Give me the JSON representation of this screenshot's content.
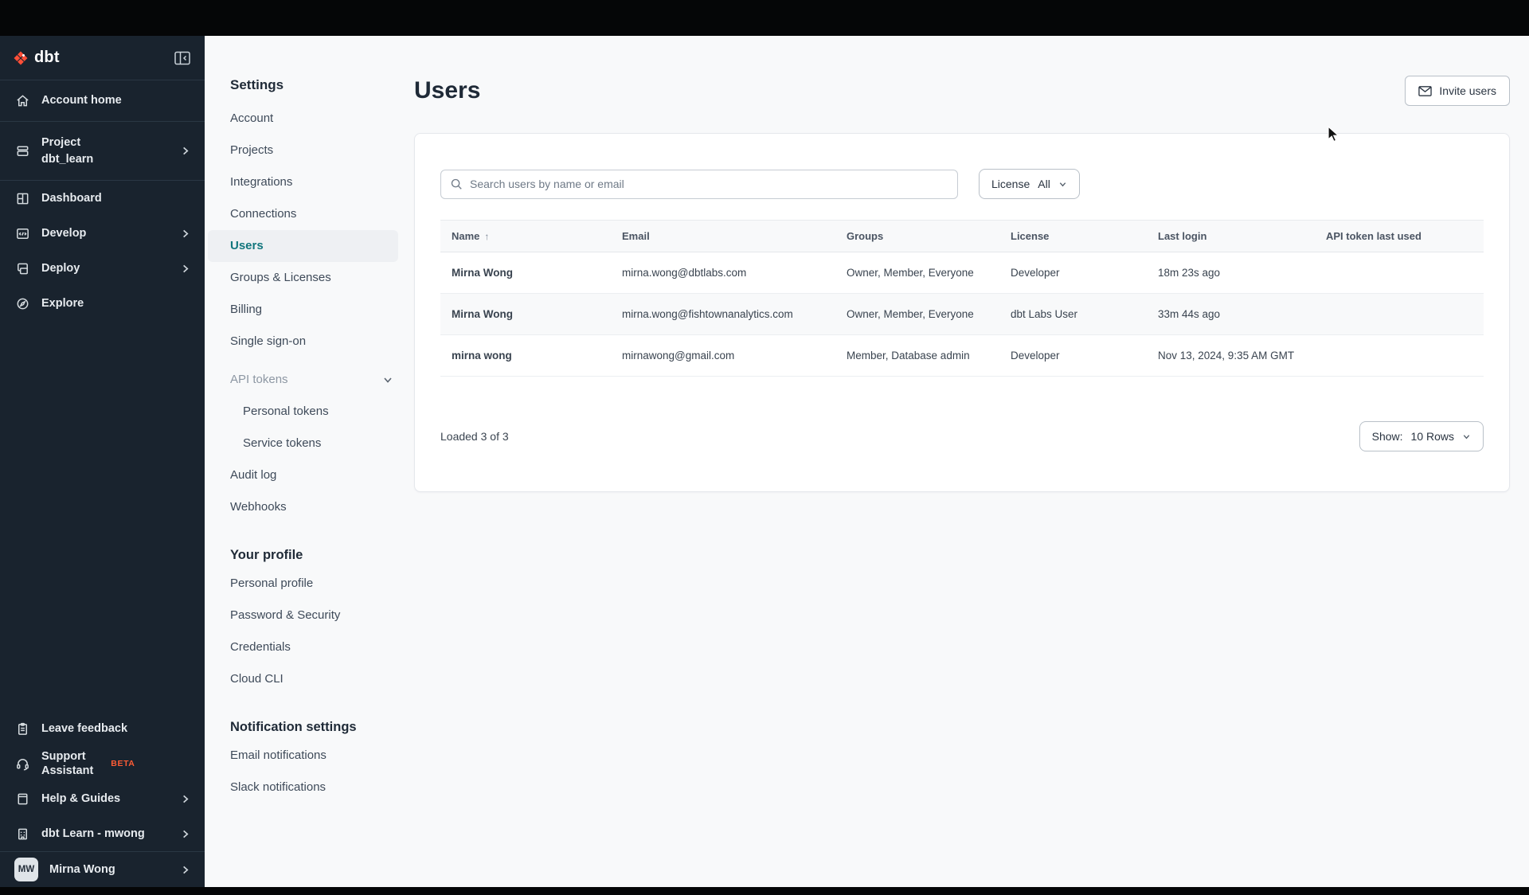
{
  "sidebar": {
    "logo_text": "dbt",
    "items": [
      {
        "label": "Account home"
      },
      {
        "label": "Project",
        "sublabel": "dbt_learn"
      },
      {
        "label": "Dashboard"
      },
      {
        "label": "Develop"
      },
      {
        "label": "Deploy"
      },
      {
        "label": "Explore"
      }
    ],
    "footer_items": [
      {
        "label": "Leave feedback"
      },
      {
        "label": "Support Assistant",
        "badge": "BETA"
      },
      {
        "label": "Help & Guides"
      },
      {
        "label": "dbt Learn - mwong"
      }
    ],
    "user": {
      "initials": "MW",
      "name": "Mirna Wong"
    }
  },
  "settings_nav": {
    "title": "Settings",
    "items": [
      "Account",
      "Projects",
      "Integrations",
      "Connections",
      "Users",
      "Groups & Licenses",
      "Billing",
      "Single sign-on"
    ],
    "active_item": "Users",
    "api_tokens_label": "API tokens",
    "api_tokens_children": [
      "Personal tokens",
      "Service tokens"
    ],
    "items_after": [
      "Audit log",
      "Webhooks"
    ],
    "profile_title": "Your profile",
    "profile_items": [
      "Personal profile",
      "Password & Security",
      "Credentials",
      "Cloud CLI"
    ],
    "notifications_title": "Notification settings",
    "notification_items": [
      "Email notifications",
      "Slack notifications"
    ]
  },
  "main": {
    "title": "Users",
    "invite_button_label": "Invite users",
    "search_placeholder": "Search users by name or email",
    "license_filter_label": "License",
    "license_filter_value": "All",
    "table": {
      "columns": [
        "Name",
        "Email",
        "Groups",
        "License",
        "Last login",
        "API token last used"
      ],
      "sort_column": "Name",
      "sort_direction": "asc",
      "rows": [
        {
          "name": "Mirna Wong",
          "email": "mirna.wong@dbtlabs.com",
          "groups": "Owner, Member, Everyone",
          "license": "Developer",
          "last_login": "18m 23s ago",
          "api_token_last_used": ""
        },
        {
          "name": "Mirna Wong",
          "email": "mirna.wong@fishtownanalytics.com",
          "groups": "Owner, Member, Everyone",
          "license": "dbt Labs User",
          "last_login": "33m 44s ago",
          "api_token_last_used": ""
        },
        {
          "name": "mirna wong",
          "email": "mirnawong@gmail.com",
          "groups": "Member, Database admin",
          "license": "Developer",
          "last_login": "Nov 13, 2024, 9:35 AM GMT",
          "api_token_last_used": ""
        }
      ]
    },
    "loaded_text": "Loaded 3 of 3",
    "show_label": "Show:",
    "show_value": "10 Rows"
  },
  "colors": {
    "accent_teal": "#12767d",
    "brand_orange": "#ff5c35",
    "sidebar_bg": "#19232e"
  }
}
